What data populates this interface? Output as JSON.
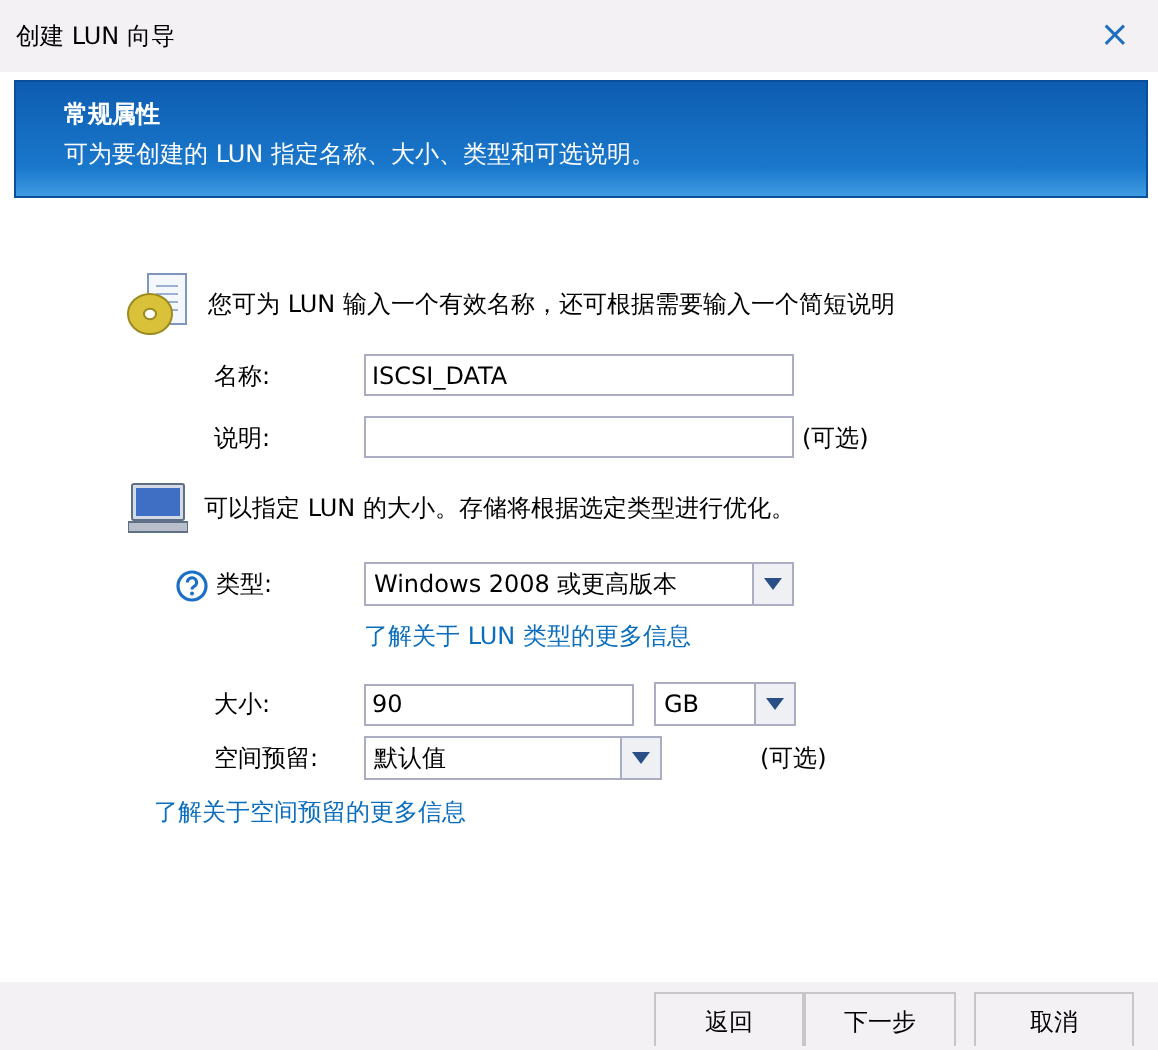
{
  "window": {
    "title": "创建 LUN 向导",
    "close": "×"
  },
  "banner": {
    "title": "常规属性",
    "subtitle": "可为要创建的 LUN 指定名称、大小、类型和可选说明。"
  },
  "name_section": {
    "intro": "您可为 LUN 输入一个有效名称，还可根据需要输入一个简短说明",
    "name": {
      "label": "名称:",
      "value": "ISCSI_DATA"
    },
    "description": {
      "label": "说明:",
      "note": "(可选)"
    }
  },
  "size_section": {
    "intro": "可以指定 LUN 的大小。存储将根据选定类型进行优化。",
    "type": {
      "label": "类型:",
      "value": "Windows 2008 或更高版本",
      "link": "了解关于 LUN 类型的更多信息"
    },
    "size": {
      "label": "大小:",
      "value": "90",
      "unit": "GB"
    },
    "reservation": {
      "label": "空间预留:",
      "value": "默认值",
      "note": "(可选)"
    },
    "link": "了解关于空间预留的更多信息"
  },
  "buttons": [
    "返回",
    "下一步",
    "取消"
  ]
}
